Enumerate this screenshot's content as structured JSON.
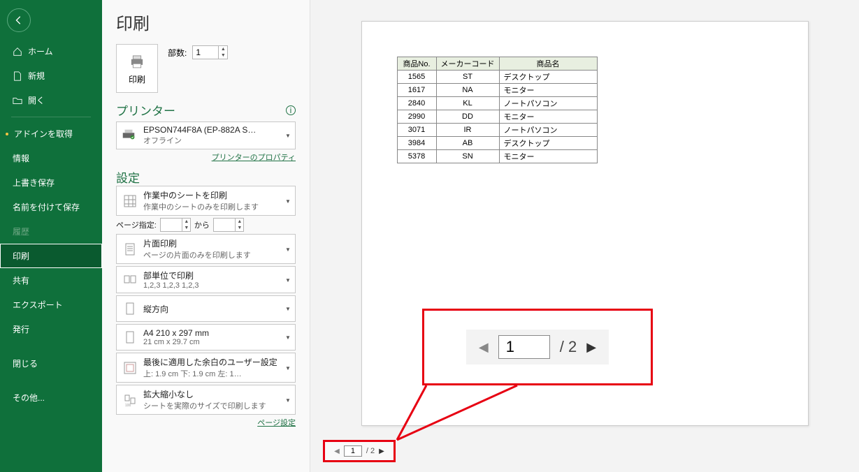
{
  "sidebar": {
    "items": [
      {
        "label": "ホーム",
        "icon": "home"
      },
      {
        "label": "新規",
        "icon": "file"
      },
      {
        "label": "開く",
        "icon": "folder"
      }
    ],
    "items2": [
      {
        "label": "アドインを取得",
        "dot": true
      },
      {
        "label": "情報"
      },
      {
        "label": "上書き保存"
      },
      {
        "label": "名前を付けて保存"
      },
      {
        "label": "履歴",
        "disabled": true
      },
      {
        "label": "印刷",
        "selected": true
      },
      {
        "label": "共有"
      },
      {
        "label": "エクスポート"
      },
      {
        "label": "発行"
      },
      {
        "label": "閉じる"
      },
      {
        "label": "その他..."
      }
    ]
  },
  "title": "印刷",
  "print_button_label": "印刷",
  "copies_label": "部数:",
  "copies_value": "1",
  "printer_section": "プリンター",
  "printer": {
    "name": "EPSON744F8A (EP-882A S…",
    "status": "オフライン"
  },
  "printer_props_link": "プリンターのプロパティ",
  "settings_section": "設定",
  "settings": [
    {
      "line1": "作業中のシートを印刷",
      "line2": "作業中のシートのみを印刷します"
    },
    {
      "line1": "片面印刷",
      "line2": "ページの片面のみを印刷します"
    },
    {
      "line1": "部単位で印刷",
      "line2": "1,2,3    1,2,3    1,2,3"
    },
    {
      "line1": "縦方向",
      "line2": ""
    },
    {
      "line1": "A4 210 x 297 mm",
      "line2": "21 cm x 29.7 cm"
    },
    {
      "line1": "最後に適用した余白のユーザー設定",
      "line2": "上: 1.9 cm 下: 1.9 cm 左: 1…"
    },
    {
      "line1": "拡大縮小なし",
      "line2": "シートを実際のサイズで印刷します"
    }
  ],
  "page_range_label": "ページ指定:",
  "page_range_to": "から",
  "page_setup_link": "ページ設定",
  "pager": {
    "current": "1",
    "total": "2"
  },
  "table": {
    "headers": [
      "商品No.",
      "メーカーコード",
      "商品名"
    ],
    "rows": [
      [
        "1565",
        "ST",
        "デスクトップ"
      ],
      [
        "1617",
        "NA",
        "モニター"
      ],
      [
        "2840",
        "KL",
        "ノートパソコン"
      ],
      [
        "2990",
        "DD",
        "モニター"
      ],
      [
        "3071",
        "IR",
        "ノートパソコン"
      ],
      [
        "3984",
        "AB",
        "デスクトップ"
      ],
      [
        "5378",
        "SN",
        "モニター"
      ]
    ]
  }
}
